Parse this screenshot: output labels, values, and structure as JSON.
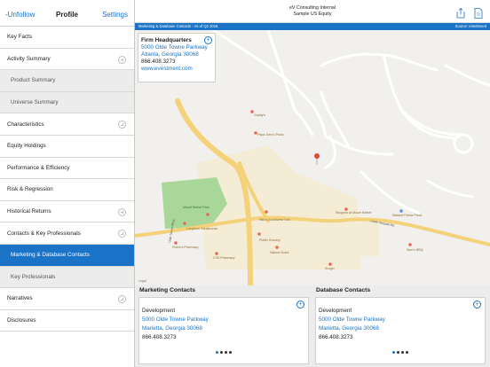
{
  "sidebar": {
    "unfollow": "-Unfollow",
    "title": "Profile",
    "settings": "Settings",
    "items": [
      {
        "label": "Key Facts"
      },
      {
        "label": "Activity Summary"
      },
      {
        "label": "Product Summary"
      },
      {
        "label": "Universe Summary"
      },
      {
        "label": "Characteristics"
      },
      {
        "label": "Equity Holdings"
      },
      {
        "label": "Performance & Efficiency"
      },
      {
        "label": "Risk & Regression"
      },
      {
        "label": "Historical Returns"
      },
      {
        "label": "Contacts & Key Professionals"
      },
      {
        "label": "Marketing & Database Contacts"
      },
      {
        "label": "Key Professionals"
      },
      {
        "label": "Narratives"
      },
      {
        "label": "Disclosures"
      }
    ]
  },
  "header": {
    "line1": "eV Consulting Internal",
    "line2": "Sample US Equity"
  },
  "bar": {
    "left": "Marketing & Database Contacts - As of Q2 2016",
    "right": "Source: eVestment"
  },
  "hq": {
    "title": "Firm Headquarters",
    "street": "5000 Olde Towne Parkway",
    "city": "Atlanta, Georgia 30068",
    "phone": "866.408.3273",
    "url": "www.evestment.com"
  },
  "map": {
    "places": [
      "Caddy's",
      "Papa John's Pizza",
      "Mount Bethel Park",
      "Longhorn Steakhouse",
      "Nick's Southwest Grill",
      "Publix Grocery",
      "Papa's",
      "Sakura Sushi",
      "Publix's Pharmacy",
      "CVS Pharmacy",
      "Kroger",
      "Sam's BBQ",
      "Shoppes at Mount Bethel",
      "Starbucks",
      "Waldorf Pointe Pizza",
      "Sam's BBQ1"
    ],
    "roads": [
      "Lower Roswell Rd",
      "Lower Roswell Rd",
      "Olde Towne Pkwy"
    ]
  },
  "marketing": {
    "header": "Marketing Contacts",
    "name": "Development",
    "street": "5000 Olde Towne Parkway",
    "city": "Marietta, Georgia 30068",
    "phone": "866.408.3273"
  },
  "database": {
    "header": "Database Contacts",
    "name": "Development",
    "street": "5000 Olde Towne Parkway",
    "city": "Marietta, Georgia 30068",
    "phone": "866.408.3273"
  },
  "colors": {
    "accent": "#1a73c7"
  }
}
